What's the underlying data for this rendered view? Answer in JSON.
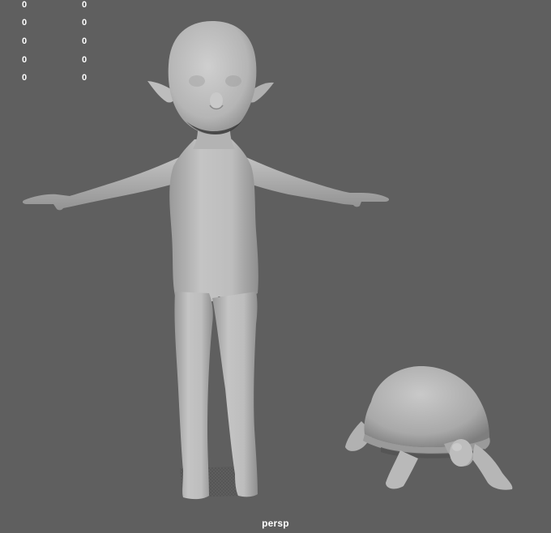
{
  "viewport": {
    "camera_label": "persp",
    "background_color": "#5f5f5f",
    "model_color": "#b8b8b8"
  },
  "hud": {
    "rows": [
      {
        "col1": "0",
        "col2": "0"
      },
      {
        "col1": "0",
        "col2": "0"
      },
      {
        "col1": "0",
        "col2": "0"
      },
      {
        "col1": "0",
        "col2": "0"
      },
      {
        "col1": "0",
        "col2": "0"
      }
    ]
  },
  "objects": [
    {
      "name": "character-model"
    },
    {
      "name": "tortoise-model"
    }
  ]
}
